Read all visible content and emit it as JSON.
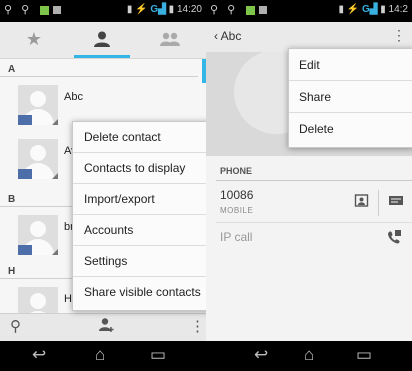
{
  "left": {
    "status": {
      "time": "14:20",
      "network": "G"
    },
    "tabs": [
      {
        "name": "favorites",
        "icon": "star-icon"
      },
      {
        "name": "contacts",
        "icon": "person-icon"
      },
      {
        "name": "groups",
        "icon": "group-icon"
      }
    ],
    "sections": [
      "A",
      "B",
      "H"
    ],
    "contacts": [
      "Abc",
      "Av",
      "br",
      "Ho"
    ],
    "menu": {
      "items": [
        "Delete contact",
        "Contacts to display",
        "Import/export",
        "Accounts",
        "Settings",
        "Share visible contacts"
      ]
    },
    "bottombar": {
      "icons": [
        "search-icon",
        "add-contact-icon",
        "overflow-menu-icon"
      ]
    }
  },
  "right": {
    "status": {
      "time": "14:2",
      "network": "G"
    },
    "title": "Abc",
    "popup": {
      "items": [
        "Edit",
        "Share",
        "Delete"
      ]
    },
    "phone": {
      "section": "PHONE",
      "number": "10086",
      "type": "MOBILE",
      "ip_call": "IP call"
    }
  },
  "colors": {
    "accent": "#33b5e5",
    "menu_bg": "#fbfbfb",
    "panel_bg": "#f3f3f3"
  }
}
